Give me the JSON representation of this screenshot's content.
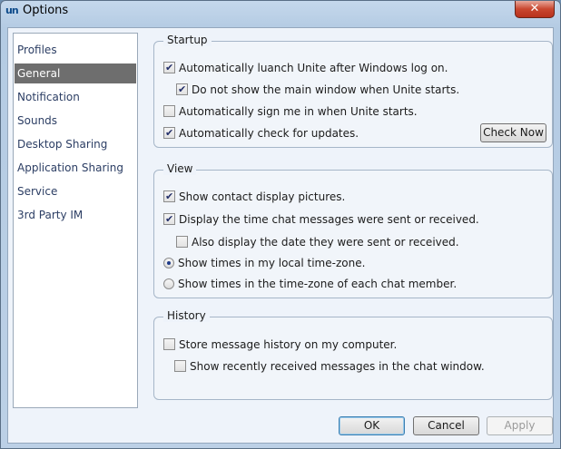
{
  "window": {
    "title": "Options",
    "app_icon_text": "un",
    "close_symbol": "✕"
  },
  "sidebar": {
    "items": [
      {
        "label": "Profiles",
        "selected": false
      },
      {
        "label": "General",
        "selected": true
      },
      {
        "label": "Notification",
        "selected": false
      },
      {
        "label": "Sounds",
        "selected": false
      },
      {
        "label": "Desktop Sharing",
        "selected": false
      },
      {
        "label": "Application  Sharing",
        "selected": false
      },
      {
        "label": "Service",
        "selected": false
      },
      {
        "label": "3rd Party IM",
        "selected": false
      }
    ]
  },
  "startup": {
    "title": "Startup",
    "auto_launch": {
      "label": "Automatically luanch Unite after Windows log on.",
      "checked": true
    },
    "hide_main": {
      "label": "Do not show the main window when Unite starts.",
      "checked": true
    },
    "auto_signin": {
      "label": "Automatically sign me in when Unite starts.",
      "checked": false
    },
    "auto_update": {
      "label": "Automatically check for updates.",
      "checked": true
    },
    "check_now_label": "Check Now"
  },
  "view": {
    "title": "View",
    "show_pictures": {
      "label": "Show contact display pictures.",
      "checked": true
    },
    "show_time": {
      "label": "Display the time chat messages were sent or received.",
      "checked": true
    },
    "show_date": {
      "label": "Also display the date they were sent or received.",
      "checked": false
    },
    "local_tz": {
      "label": "Show times in my local time-zone.",
      "checked": true
    },
    "member_tz": {
      "label": "Show times in the time-zone of each chat member.",
      "checked": false
    }
  },
  "history": {
    "title": "History",
    "store": {
      "label": "Store message history on my computer.",
      "checked": false
    },
    "recent": {
      "label": "Show recently received messages in the chat window.",
      "checked": false
    }
  },
  "buttons": {
    "ok": "OK",
    "cancel": "Cancel",
    "apply": "Apply"
  }
}
